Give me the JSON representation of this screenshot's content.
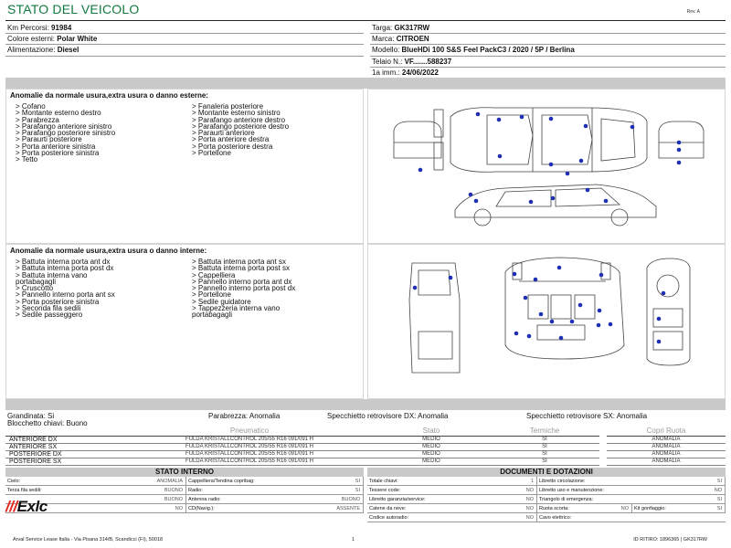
{
  "header": {
    "title": "STATO DEL VEICOLO",
    "revision": "Rev. A"
  },
  "vehicle": {
    "km_label": "Km Percorsi:",
    "km_value": "91984",
    "colore_label": "Colore esterni:",
    "colore_value": "Polar White",
    "alim_label": "Alimentazione:",
    "alim_value": "Diesel",
    "targa_label": "Targa:",
    "targa_value": "GK317RW",
    "marca_label": "Marca:",
    "marca_value": "CITROEN",
    "modello_label": "Modello:",
    "modello_value": "BlueHDi 100 S&S Feel PackC3 / 2020 / 5P / Berlina",
    "telaio_label": "Telaio N.:",
    "telaio_value": "VF.......588237",
    "imm_label": "1a imm.:",
    "imm_value": "24/06/2022"
  },
  "exterior": {
    "title": "Anomalie da normale usura,extra usura o danno esterne:",
    "col1": [
      "> Cofano",
      "> Montante esterno destro",
      "> Parabrezza",
      "> Parafango anteriore sinistro",
      "> Parafango posteriore sinistro",
      "> Paraurti posteriore",
      "> Porta anteriore sinistra",
      "> Porta posteriore sinistra",
      "> Tetto"
    ],
    "col2": [
      "> Fanaleria posteriore",
      "> Montante esterno sinistro",
      "> Parafango anteriore destro",
      "> Parafango posteriore destro",
      "> Paraurti anteriore",
      "> Porta anteriore destra",
      "> Porta posteriore destra",
      "> Portellone"
    ]
  },
  "interior": {
    "title": "Anomalie da normale usura,extra usura o danno interne:",
    "col1": [
      "> Battuta interna porta ant dx",
      "> Battuta interna porta post dx",
      "> Battuta interna vano",
      "portabagagli",
      "> Cruscotto",
      "> Pannello interno porta ant sx",
      "> Porta posteriore sinistra",
      "> Seconda fila sedili",
      "> Sedile passeggero"
    ],
    "col2": [
      "> Battuta interna porta ant sx",
      "> Battuta interna porta post sx",
      "> Cappelliera",
      "> Pannello interno porta ant dx",
      "> Pannello interno porta post dx",
      "> Portellone",
      "> Sedile guidatore",
      "> Tappezzeria interna vano",
      "portabagagli"
    ]
  },
  "summary": {
    "grandinata": "Grandinata: Si",
    "parabrezza": "Parabrezza: Anomalia",
    "specchietto_dx": "Specchietto retrovisore DX: Anomalia",
    "specchietto_sx": "Specchietto retrovisore SX: Anomalia",
    "blocchetto": "Blocchetto chiavi: Buono"
  },
  "tyres": {
    "headers": [
      "",
      "Pneumatico",
      "Stato",
      "Termiche",
      "Copri Ruota"
    ],
    "rows": [
      {
        "pos": "ANTERIORE DX",
        "tyre": "FULDA KRISTALLCONTROL 205/55 R16 091/091 H",
        "stato": "MEDIO",
        "termiche": "SI",
        "copri": "ANOMALIA"
      },
      {
        "pos": "ANTERIORE SX",
        "tyre": "FULDA KRISTALLCONTROL 205/55 R16 091/091 H",
        "stato": "MEDIO",
        "termiche": "SI",
        "copri": "ANOMALIA"
      },
      {
        "pos": "POSTERIORE DX",
        "tyre": "FULDA KRISTALLCONTROL 205/55 R16 091/091 H",
        "stato": "MEDIO",
        "termiche": "SI",
        "copri": "ANOMALIA"
      },
      {
        "pos": "POSTERIORE SX",
        "tyre": "FULDA KRISTALLCONTROL 205/55 R16 091/091 H",
        "stato": "MEDIO",
        "termiche": "SI",
        "copri": "ANOMALIA"
      }
    ]
  },
  "stato_interno": {
    "title": "STATO INTERNO",
    "rows": [
      {
        "a": "Cielo:",
        "av": "ANOMALIA",
        "b": "Cappelliera/Tendina copribag:",
        "bv": "SI"
      },
      {
        "a": "Terza fila sedili:",
        "av": "BUONO",
        "b": "Radio:",
        "bv": "SI"
      },
      {
        "a": "",
        "av": "BUONO",
        "b": "Antenna radio:",
        "bv": "BUONO"
      },
      {
        "a": "",
        "av": "NO",
        "b": "CD(Navig.):",
        "bv": "ASSENTE"
      }
    ]
  },
  "documenti": {
    "title": "DOCUMENTI E DOTAZIONI",
    "rows": [
      {
        "a": "Totale chiavi:",
        "av": "1",
        "b": "Libretto circolazione:",
        "bv": "SI",
        "c": "",
        "cv": ""
      },
      {
        "a": "Tessere code:",
        "av": "NO",
        "b": "Libretto uso e manutenzione:",
        "bv": "NO",
        "c": "",
        "cv": ""
      },
      {
        "a": "Libretto garanzia/service:",
        "av": "NO",
        "b": "Triangolo di emergenza:",
        "bv": "SI",
        "c": "",
        "cv": ""
      },
      {
        "a": "Catene da neve:",
        "av": "NO",
        "b": "Ruota scorta:",
        "bv": "NO",
        "c": "Kit gonfiaggio:",
        "cv": "SI"
      },
      {
        "a": "Codice autoradio:",
        "av": "NO",
        "b": "Cavo elettrico:",
        "bv": "",
        "c": "",
        "cv": ""
      }
    ]
  },
  "logo": {
    "bars": "///",
    "text": "Exlc"
  },
  "footer": {
    "company": "Arval Service Lease Italia - Via Pisana 314/B, Scandicci (FI), 50018",
    "page": "1",
    "id_ritiro": "ID RITIRO: 1896365 | GK317RW"
  },
  "colors": {
    "title_green": "#0f7a3e",
    "dot_blue": "#1e2fb5",
    "band_gray": "#c9c9c9",
    "logo_red": "#e2241a"
  },
  "icons": [
    "car-exterior-diagram",
    "car-interior-diagram",
    "damage-dot"
  ]
}
